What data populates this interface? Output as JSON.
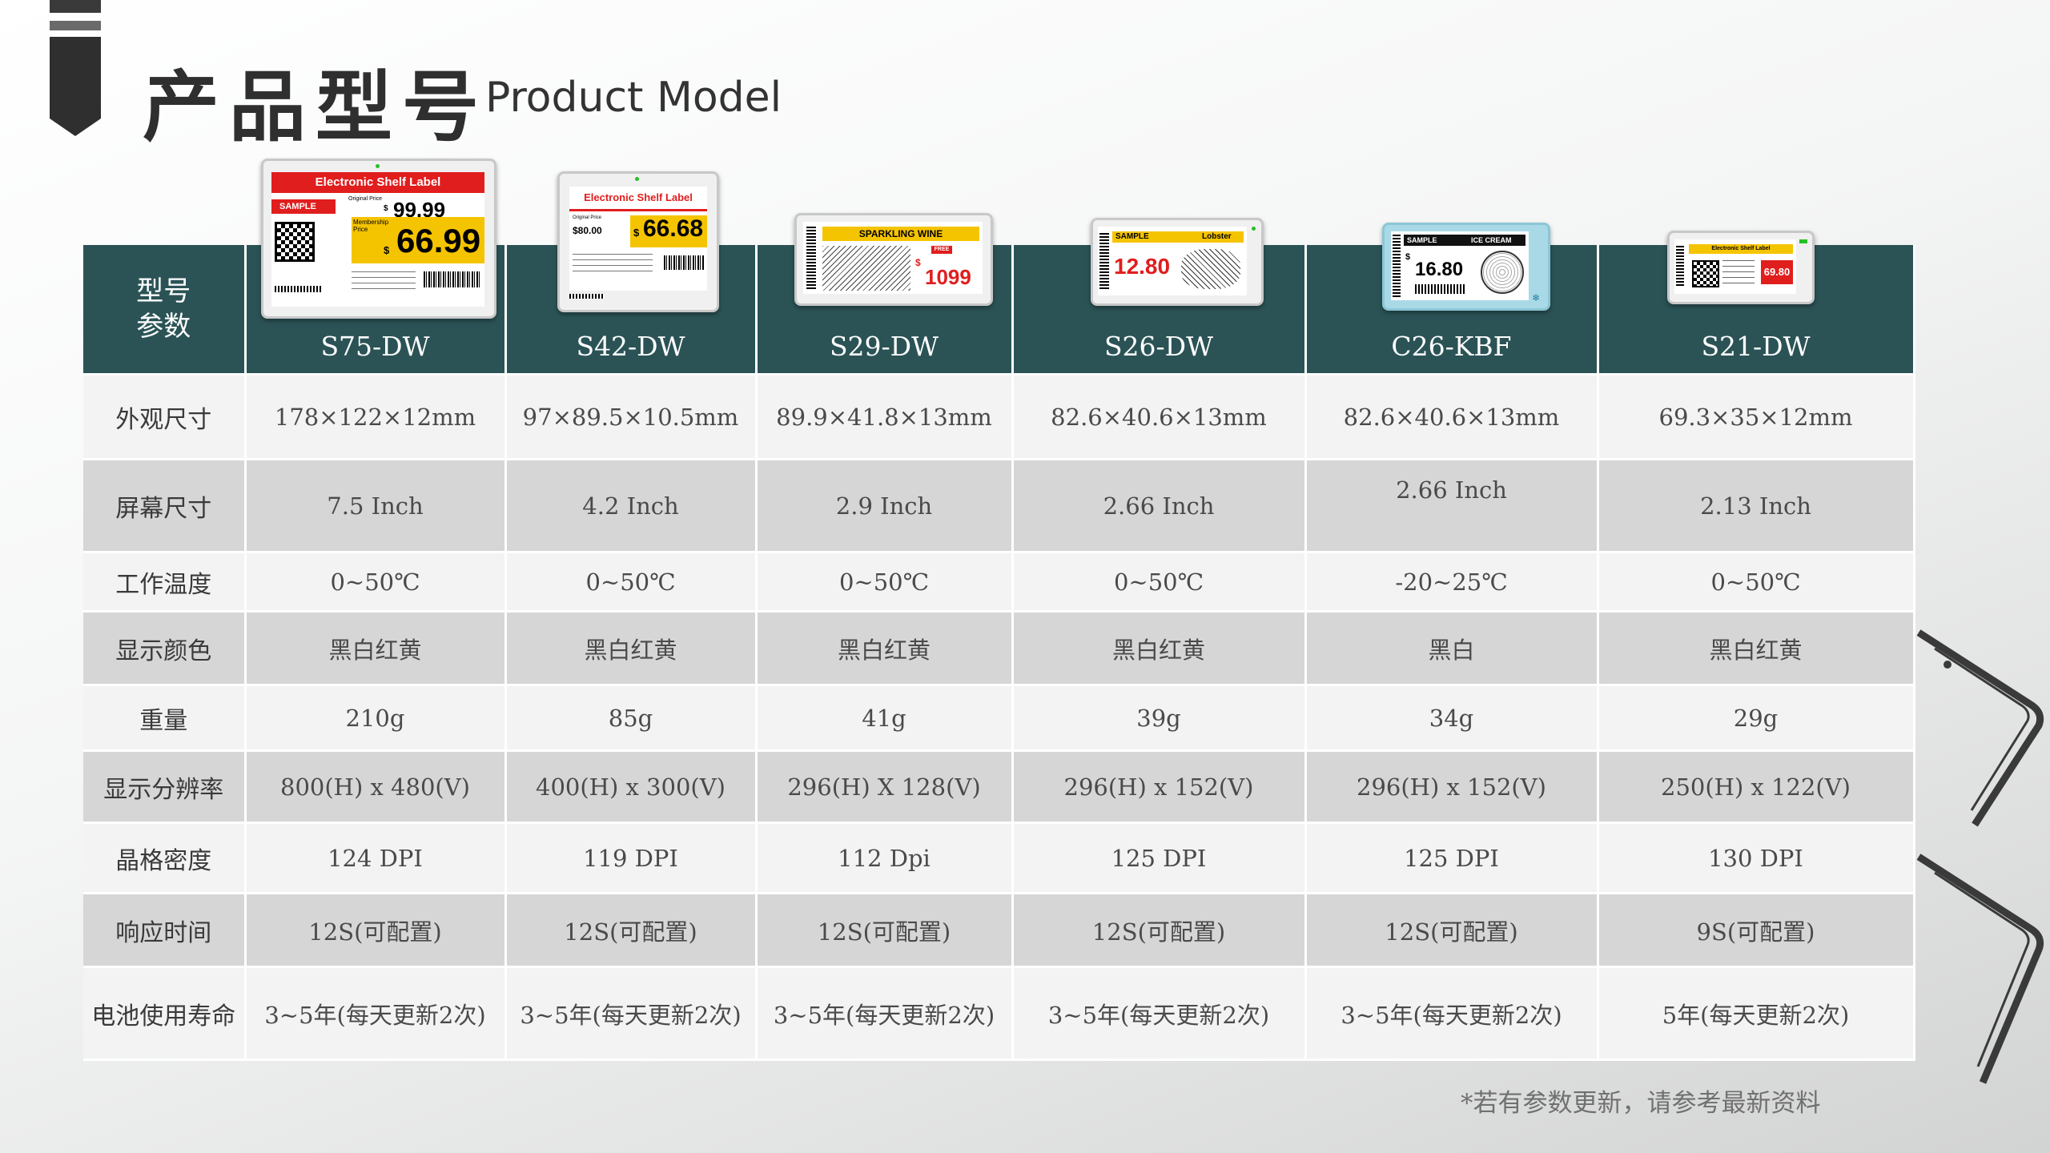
{
  "header": {
    "title_cn": "产品型号",
    "title_en": "Product Model"
  },
  "table": {
    "corner_label": "型号\n参数",
    "models": [
      "S75-DW",
      "S42-DW",
      "S29-DW",
      "S26-DW",
      "C26-KBF",
      "S21-DW"
    ],
    "rows": [
      {
        "label": "外观尺寸",
        "values": [
          "178×122×12mm",
          "97×89.5×10.5mm",
          "89.9×41.8×13mm",
          "82.6×40.6×13mm",
          "82.6×40.6×13mm",
          "69.3×35×12mm"
        ]
      },
      {
        "label": "屏幕尺寸",
        "values": [
          "7.5 Inch",
          "4.2 Inch",
          "2.9 Inch",
          "2.66 Inch",
          "2.66 Inch",
          "2.13 Inch"
        ]
      },
      {
        "label": "工作温度",
        "values": [
          "0~50℃",
          "0~50℃",
          "0~50℃",
          "0~50℃",
          "-20~25℃",
          "0~50℃"
        ]
      },
      {
        "label": "显示颜色",
        "values": [
          "黑白红黄",
          "黑白红黄",
          "黑白红黄",
          "黑白红黄",
          "黑白",
          "黑白红黄"
        ]
      },
      {
        "label": "重量",
        "values": [
          "210g",
          "85g",
          "41g",
          "39g",
          "34g",
          "29g"
        ]
      },
      {
        "label": "显示分辨率",
        "values": [
          "800(H) x 480(V)",
          "400(H) x 300(V)",
          "296(H) X 128(V)",
          "296(H) x 152(V)",
          "296(H) x 152(V)",
          "250(H) x 122(V)"
        ]
      },
      {
        "label": "晶格密度",
        "values": [
          "124 DPI",
          "119 DPI",
          "112 Dpi",
          "125 DPI",
          "125 DPI",
          "130 DPI"
        ]
      },
      {
        "label": "响应时间",
        "values": [
          "12S(可配置)",
          "12S(可配置)",
          "12S(可配置)",
          "12S(可配置)",
          "12S(可配置)",
          "9S(可配置)"
        ]
      },
      {
        "label": "电池使用寿命",
        "values": [
          "3~5年(每天更新2次)",
          "3~5年(每天更新2次)",
          "3~5年(每天更新2次)",
          "3~5年(每天更新2次)",
          "3~5年(每天更新2次)",
          "5年(每天更新2次)"
        ]
      }
    ]
  },
  "products": {
    "s75": {
      "banner": "Electronic Shelf Label",
      "tag": "SAMPLE",
      "orig_label": "Original Price",
      "orig_price_sym": "$",
      "orig_price": "99.99",
      "member_label": "Membership Price",
      "member_price_sym": "$",
      "member_price": "66.99"
    },
    "s42": {
      "banner": "Electronic Shelf Label",
      "orig_label": "Original Price",
      "orig_price": "$80.00",
      "price_sym": "$",
      "price": "66.68"
    },
    "s29": {
      "banner": "SPARKLING WINE",
      "badge": "FREE",
      "price_sym": "$",
      "price": "1099"
    },
    "s26": {
      "tag": "SAMPLE",
      "item": "Lobster",
      "price": "12.80"
    },
    "c26": {
      "tag": "SAMPLE",
      "item": "ICE CREAM",
      "price_sym": "$",
      "price": "16.80"
    },
    "s21": {
      "banner": "Electronic Shelf Label",
      "price": "69.80"
    }
  },
  "footnote": "*若有参数更新，请参考最新资料",
  "colors": {
    "header_bg": "#2b5356",
    "row_light": "#f3f3f3",
    "row_dark": "#d6d6d6",
    "label_red": "#e01e1e",
    "label_yellow": "#f5c400",
    "c26_frame": "#a9d9e6"
  }
}
